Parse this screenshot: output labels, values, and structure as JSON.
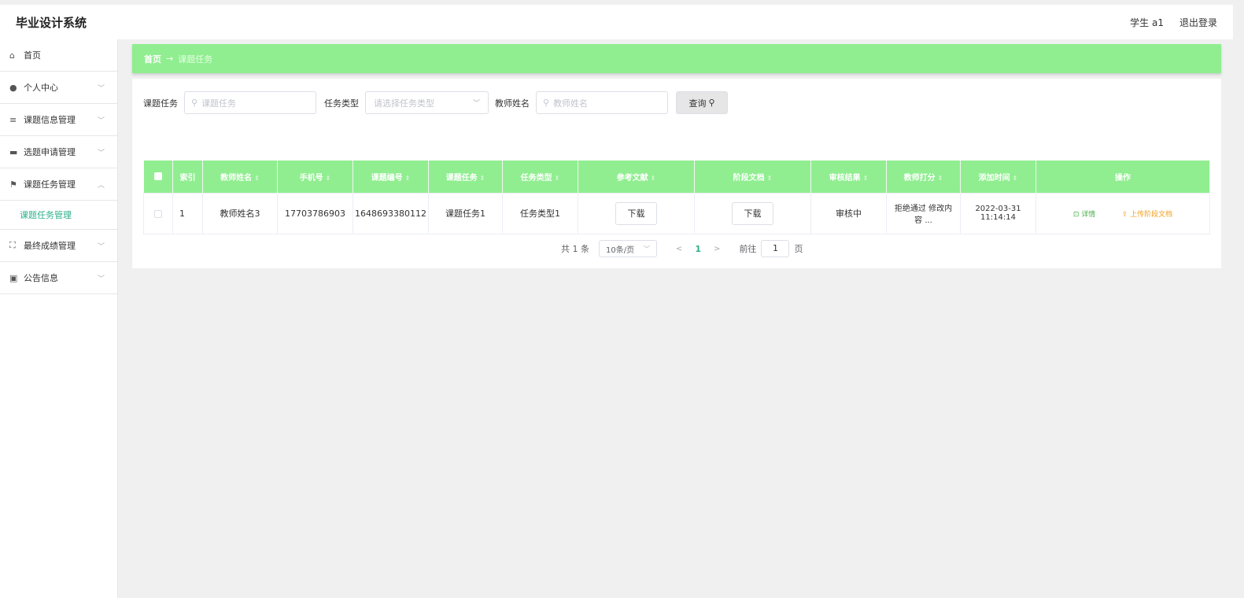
{
  "app": {
    "title": "毕业设计系统",
    "user_label": "学生 a1",
    "logout_label": "退出登录"
  },
  "sidebar": {
    "items": [
      {
        "icon": "home-icon",
        "label": "首页"
      },
      {
        "icon": "user-icon",
        "label": "个人中心"
      },
      {
        "icon": "list-icon",
        "label": "课题信息管理"
      },
      {
        "icon": "monitor-icon",
        "label": "选题申请管理"
      },
      {
        "icon": "flag-icon",
        "label": "课题任务管理"
      },
      {
        "icon": "fullscreen-icon",
        "label": "最终成绩管理"
      },
      {
        "icon": "notice-icon",
        "label": "公告信息"
      }
    ],
    "active_sub": "课题任务管理"
  },
  "breadcrumb": {
    "home": "首页",
    "separator": "→",
    "current": "课题任务"
  },
  "search": {
    "task_label": "课题任务",
    "task_placeholder": "课题任务",
    "type_label": "任务类型",
    "type_placeholder": "请选择任务类型",
    "teacher_label": "教师姓名",
    "teacher_placeholder": "教师姓名",
    "query_button": "查询"
  },
  "table": {
    "headers": [
      "索引",
      "教师姓名",
      "手机号",
      "课题编号",
      "课题任务",
      "任务类型",
      "参考文献",
      "阶段文档",
      "审核结果",
      "教师打分",
      "添加时间",
      "操作"
    ],
    "rows": [
      {
        "index": "1",
        "teacher": "教师姓名3",
        "phone": "17703786903",
        "topic_no": "1648693380112",
        "task": "课题任务1",
        "task_type": "任务类型1",
        "ref_button": "下载",
        "stage_button": "下载",
        "review": "审核中",
        "score": "拒绝通过 修改内容 ...",
        "time": "2022-03-31 11:14:14",
        "action_detail": "详情",
        "action_upload": "上传阶段文档"
      }
    ]
  },
  "pagination": {
    "total": "共 1 条",
    "page_size": "10条/页",
    "current_page": "1",
    "goto_label": "前往",
    "goto_value": "1",
    "page_suffix": "页"
  },
  "colors": {
    "accent_green": "#90ee90",
    "link_teal": "#2ab08a",
    "detail_green": "#4cae4c",
    "upload_orange": "#f0a020"
  }
}
